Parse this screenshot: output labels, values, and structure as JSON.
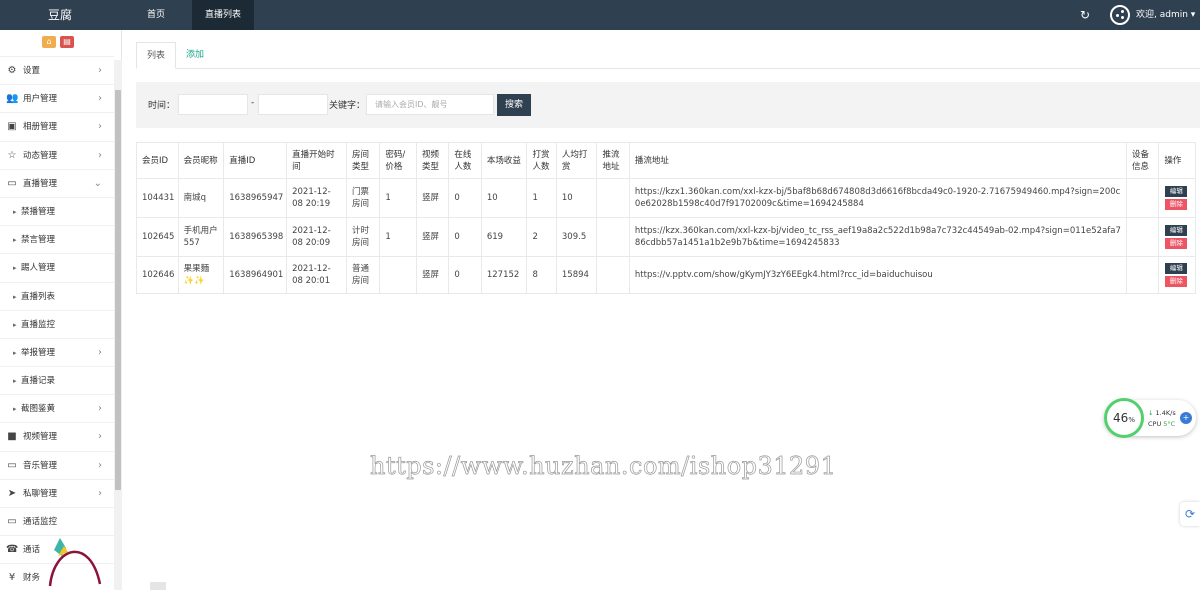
{
  "topbar": {
    "brand": "豆腐",
    "tabs": [
      "首页",
      "直播列表"
    ],
    "welcome": "欢迎, admin ▾"
  },
  "sidebar": {
    "items": [
      {
        "label": "设置",
        "icon": "gears-icon",
        "chevron": true
      },
      {
        "label": "用户管理",
        "icon": "users-icon",
        "chevron": true
      },
      {
        "label": "相册管理",
        "icon": "image-icon",
        "chevron": true
      },
      {
        "label": "动态管理",
        "icon": "star-icon",
        "chevron": true
      },
      {
        "label": "直播管理",
        "icon": "monitor-icon",
        "chevron": true,
        "open": true
      },
      {
        "label": "禁播管理",
        "sub": true
      },
      {
        "label": "禁言管理",
        "sub": true
      },
      {
        "label": "踢人管理",
        "sub": true
      },
      {
        "label": "直播列表",
        "sub": true
      },
      {
        "label": "直播监控",
        "sub": true
      },
      {
        "label": "举报管理",
        "sub": true,
        "chevron": true
      },
      {
        "label": "直播记录",
        "sub": true
      },
      {
        "label": "截图鉴黄",
        "sub": true,
        "chevron": true
      },
      {
        "label": "视频管理",
        "icon": "video-icon",
        "chevron": true
      },
      {
        "label": "音乐管理",
        "icon": "monitor-icon",
        "chevron": true
      },
      {
        "label": "私聊管理",
        "icon": "telegram-icon",
        "chevron": true
      },
      {
        "label": "通话监控",
        "icon": "monitor-icon",
        "chevron": false
      },
      {
        "label": "通话",
        "icon": "phone-icon",
        "chevron": false
      },
      {
        "label": "财务",
        "icon": "yen-icon",
        "chevron": false
      }
    ]
  },
  "tabs": {
    "list": "列表",
    "add": "添加"
  },
  "filter": {
    "time_label": "时间：",
    "dash": "-",
    "keyword_label": "关键字：",
    "keyword_placeholder": "请输入会员ID、靓号",
    "search_button": "搜索"
  },
  "table": {
    "headers": [
      "会员ID",
      "会员昵称",
      "直播ID",
      "直播开始时间",
      "房间类型",
      "密码/价格",
      "视频类型",
      "在线人数",
      "本场收益",
      "打赏人数",
      "人均打赏",
      "推流地址",
      "播流地址",
      "设备信息",
      "操作"
    ],
    "rows": [
      {
        "uid": "104431",
        "nick": "南城q",
        "liveid": "1638965947",
        "start": "2021-12-08 20:19",
        "room": "门票房间",
        "pwd": "1",
        "vtype": "竖屏",
        "online": "0",
        "income": "10",
        "tippers": "1",
        "avg": "10",
        "push": "",
        "pull": "https://kzx1.360kan.com/xxl-kzx-bj/5baf8b68d674808d3d6616f8bcda49c0-1920-2.71675949460.mp4?sign=200c0e62028b1598c40d7f91702009c&time=1694245884",
        "device": ""
      },
      {
        "uid": "102645",
        "nick": "手机用户557",
        "liveid": "1638965398",
        "start": "2021-12-08 20:09",
        "room": "计时房间",
        "pwd": "1",
        "vtype": "竖屏",
        "online": "0",
        "income": "619",
        "tippers": "2",
        "avg": "309.5",
        "push": "",
        "pull": "https://kzx.360kan.com/xxl-kzx-bj/video_tc_rss_aef19a8a2c522d1b98a7c732c44549ab-02.mp4?sign=011e52afa786cdbb57a1451a1b2e9b7b&time=1694245833",
        "device": ""
      },
      {
        "uid": "102646",
        "nick": "果果麵✨✨",
        "liveid": "1638964901",
        "start": "2021-12-08 20:01",
        "room": "普通房间",
        "pwd": "",
        "vtype": "竖屏",
        "online": "0",
        "income": "127152",
        "tippers": "8",
        "avg": "15894",
        "push": "",
        "pull": "https://v.pptv.com/show/gKymJY3zY6EEgk4.html?rcc_id=baiduchuisou",
        "device": ""
      }
    ],
    "edit_label": "编辑",
    "delete_label": "删除"
  },
  "watermark": "https://www.huzhan.com/ishop31291",
  "cpu_widget": {
    "percent": "46",
    "unit": "%",
    "speed": "1.4K/s",
    "cpu_label": "CPU",
    "temp": "5°C"
  }
}
